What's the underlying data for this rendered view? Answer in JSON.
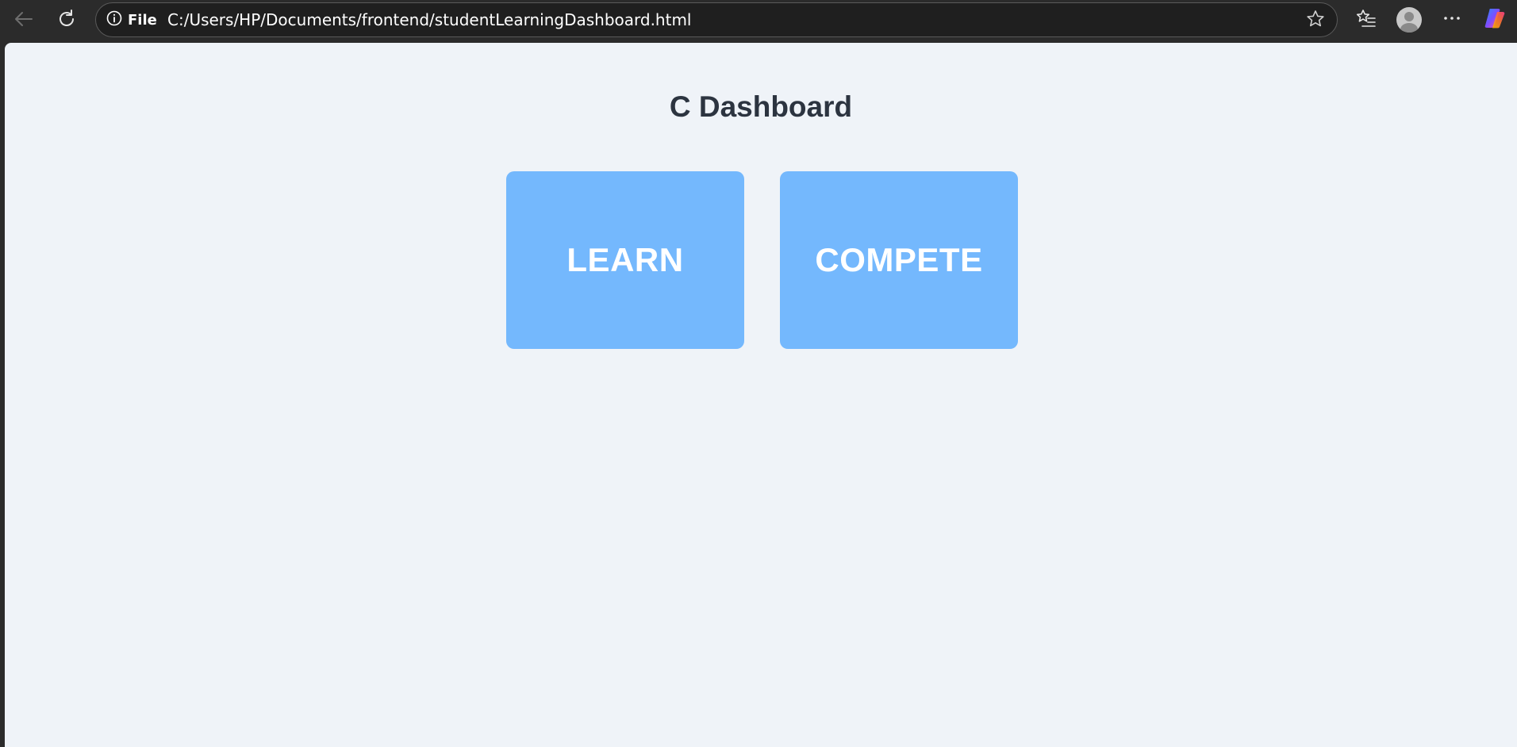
{
  "browser": {
    "site_info_label": "File",
    "url": "C:/Users/HP/Documents/frontend/studentLearningDashboard.html"
  },
  "page": {
    "title": "C Dashboard",
    "cards": [
      {
        "label": "LEARN"
      },
      {
        "label": "COMPETE"
      }
    ]
  },
  "colors": {
    "page_background": "#eff3f8",
    "card_background": "#74b8fd",
    "card_text": "#ffffff",
    "title_text": "#2c3440",
    "chrome_background": "#2b2b2b"
  },
  "icons": {
    "back": "back-arrow-icon",
    "reload": "reload-icon",
    "site_info": "info-icon",
    "favorite": "star-icon",
    "favorites": "favorites-list-icon",
    "profile": "profile-avatar-icon",
    "more": "more-dots-icon",
    "copilot": "copilot-icon"
  }
}
